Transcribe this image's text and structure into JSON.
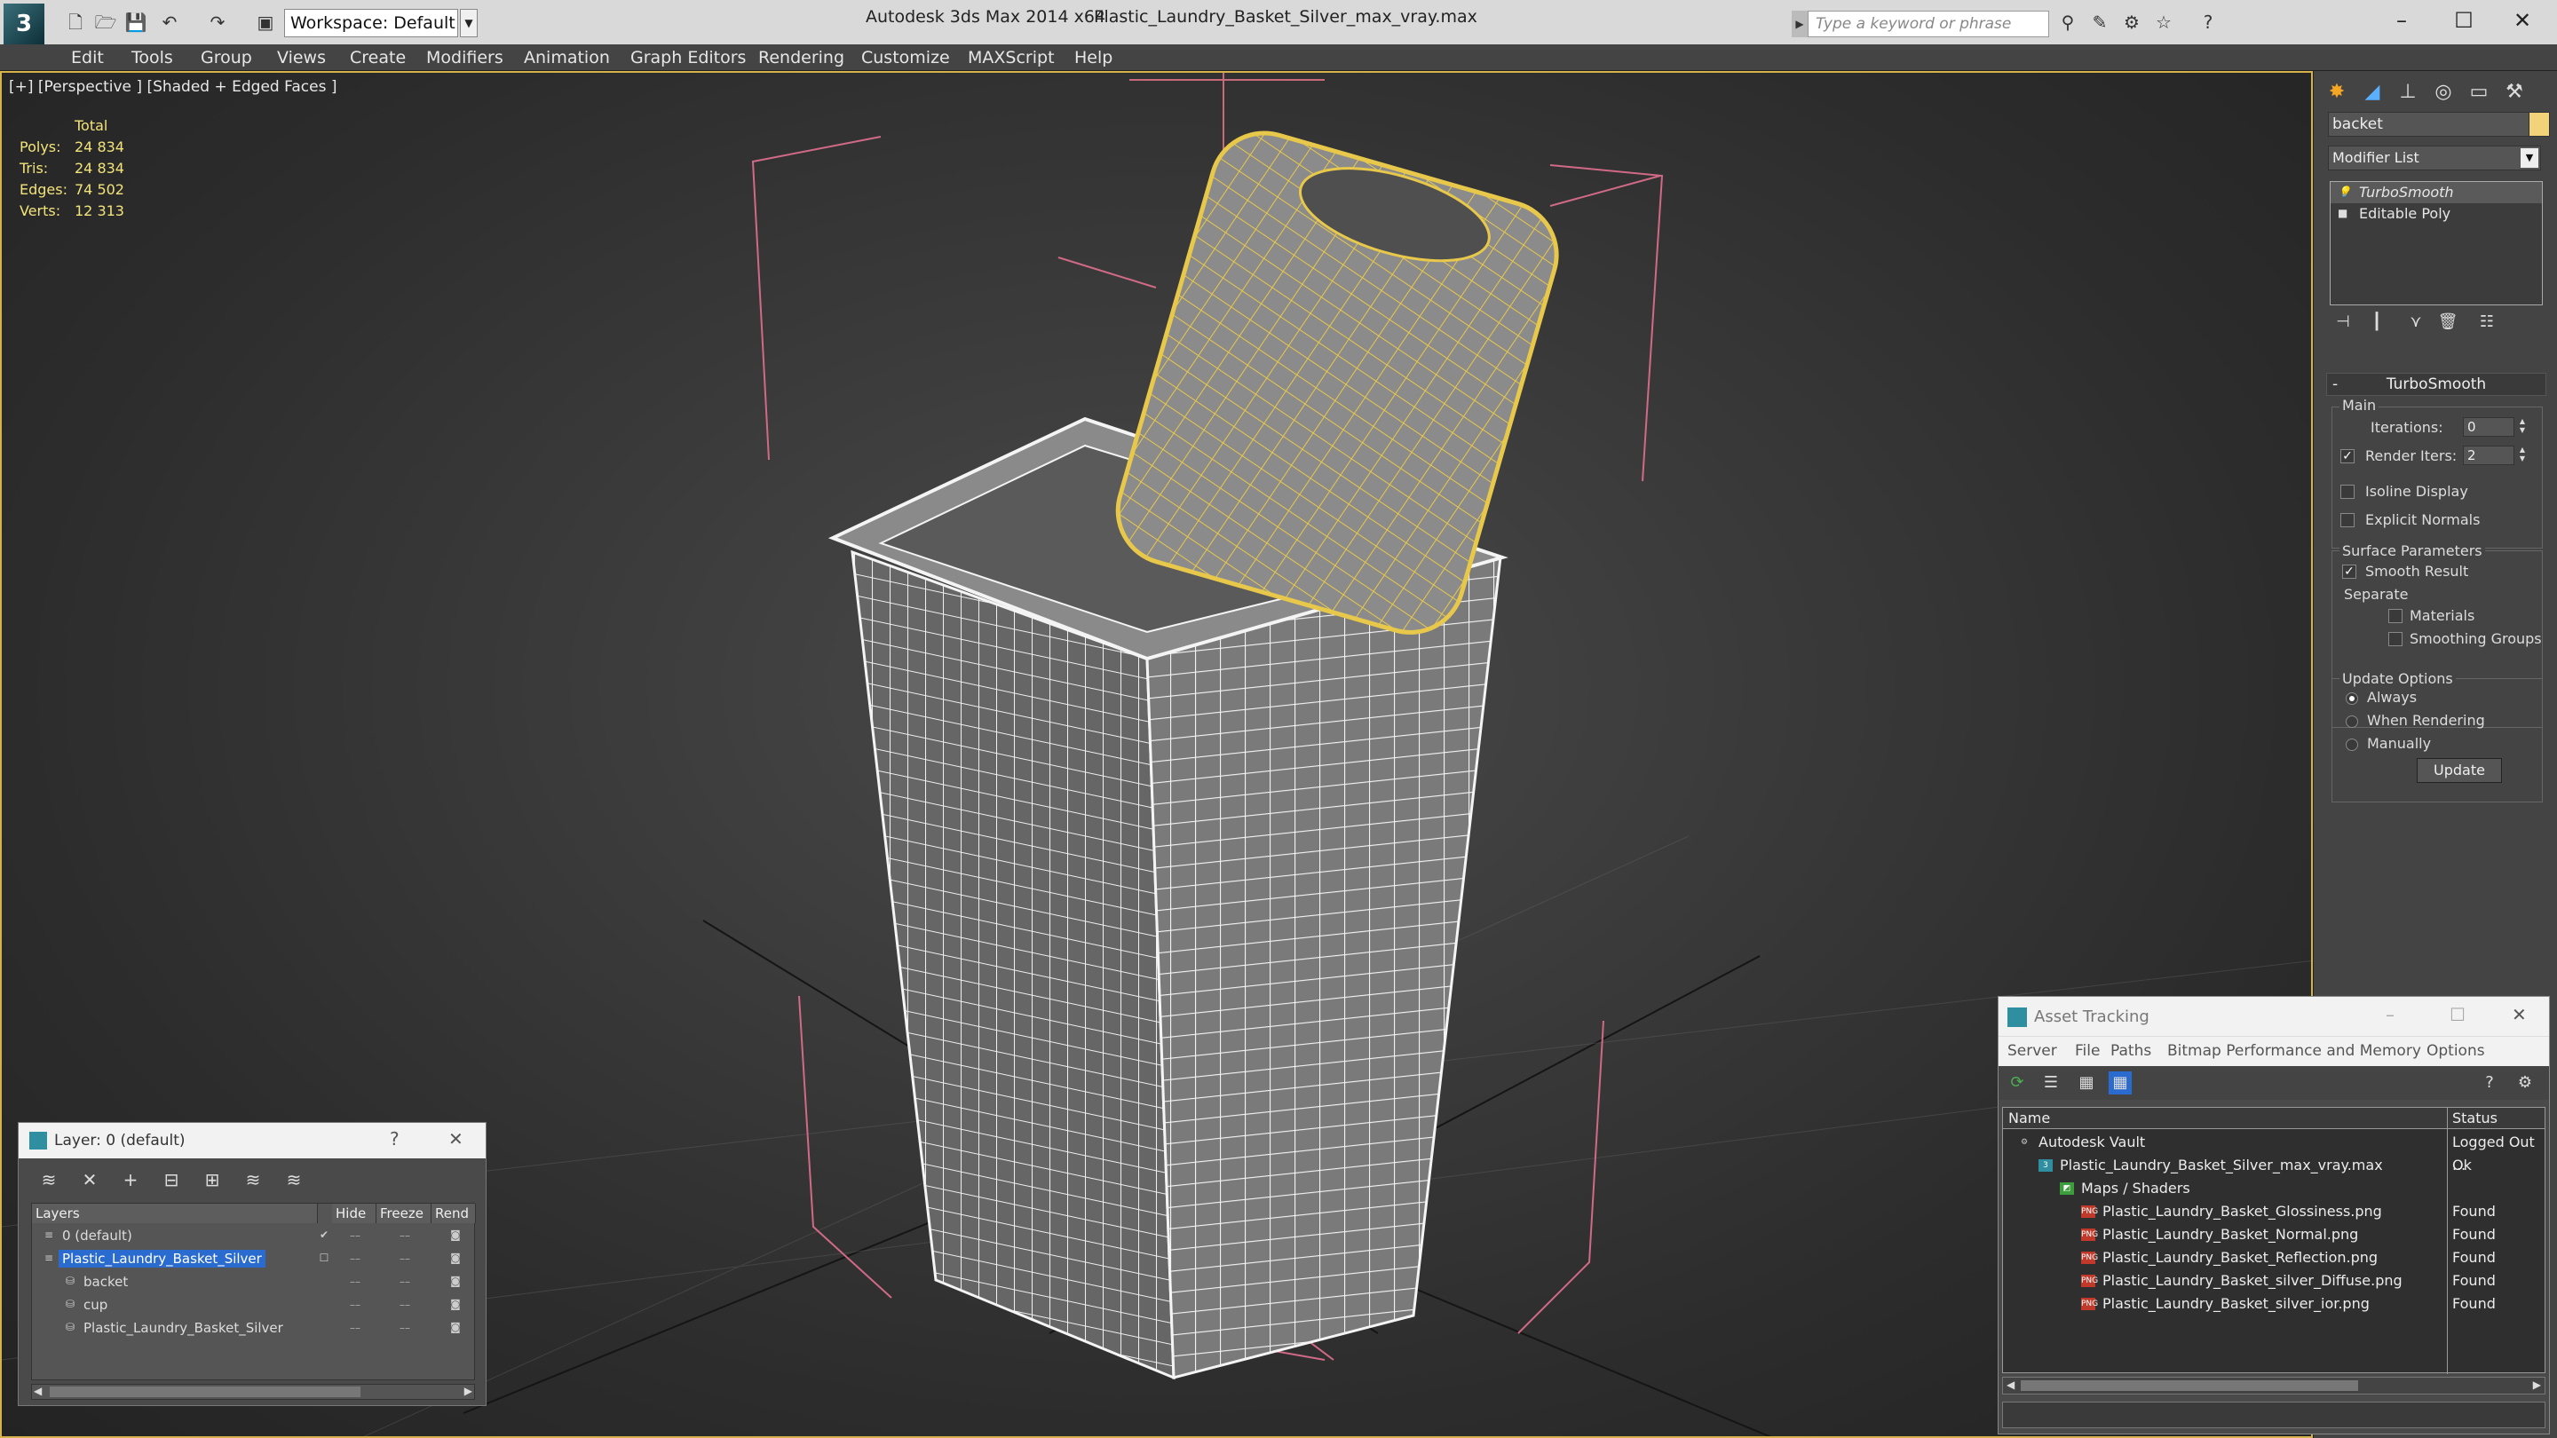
{
  "titlebar": {
    "workspace": "Workspace: Default",
    "app_title": "Autodesk 3ds Max  2014 x64",
    "file_title": "Plastic_Laundry_Basket_Silver_max_vray.max",
    "search_placeholder": "Type a keyword or phrase"
  },
  "menu": [
    "Edit",
    "Tools",
    "Group",
    "Views",
    "Create",
    "Modifiers",
    "Animation",
    "Graph Editors",
    "Rendering",
    "Customize",
    "MAXScript",
    "Help"
  ],
  "viewport": {
    "label": "[+] [Perspective ] [Shaded + Edged Faces ]",
    "stats": {
      "header": "Total",
      "rows": [
        {
          "name": "Polys:",
          "value": "24 834"
        },
        {
          "name": "Tris:",
          "value": "24 834"
        },
        {
          "name": "Edges:",
          "value": "74 502"
        },
        {
          "name": "Verts:",
          "value": "12 313"
        }
      ]
    }
  },
  "command_panel": {
    "object_name": "backet",
    "object_color": "#f3d37a",
    "modifier_list": "Modifier List",
    "stack": [
      "TurboSmooth",
      "Editable Poly"
    ],
    "rollout_title": "TurboSmooth",
    "main_group": "Main",
    "iterations_label": "Iterations:",
    "iterations_value": "0",
    "render_iters_label": "Render Iters:",
    "render_iters_value": "2",
    "render_iters_checked": true,
    "isoline_label": "Isoline Display",
    "explicit_normals_label": "Explicit Normals",
    "surface_group": "Surface Parameters",
    "smooth_result_label": "Smooth Result",
    "separate_label": "Separate",
    "materials_label": "Materials",
    "smoothing_groups_label": "Smoothing Groups",
    "update_group": "Update Options",
    "always_label": "Always",
    "when_rendering_label": "When Rendering",
    "manually_label": "Manually",
    "update_button": "Update"
  },
  "layer_dialog": {
    "title": "Layer: 0 (default)",
    "help": "?",
    "close": "✕",
    "columns": [
      "Layers",
      "Hide",
      "Freeze",
      "Rend"
    ],
    "rows": [
      {
        "name": "0 (default)",
        "indent": 0,
        "selected": false,
        "checked": true
      },
      {
        "name": "Plastic_Laundry_Basket_Silver",
        "indent": 0,
        "selected": true,
        "checked": false
      },
      {
        "name": "backet",
        "indent": 1,
        "selected": false,
        "checked": false
      },
      {
        "name": "cup",
        "indent": 1,
        "selected": false,
        "checked": false
      },
      {
        "name": "Plastic_Laundry_Basket_Silver",
        "indent": 1,
        "selected": false,
        "checked": false
      }
    ]
  },
  "asset_dialog": {
    "title": "Asset Tracking",
    "menu": [
      "Server",
      "File",
      "Paths",
      "Bitmap Performance and Memory",
      "Options"
    ],
    "columns": [
      "Name",
      "Status"
    ],
    "rows": [
      {
        "name": "Autodesk Vault",
        "status": "Logged Out ...",
        "indent": 0,
        "icon": "vault-icon"
      },
      {
        "name": "Plastic_Laundry_Basket_Silver_max_vray.max",
        "status": "Ok",
        "indent": 1,
        "icon": "max-file-icon"
      },
      {
        "name": "Maps / Shaders",
        "status": "",
        "indent": 2,
        "icon": "maps-icon"
      },
      {
        "name": "Plastic_Laundry_Basket_Glossiness.png",
        "status": "Found",
        "indent": 3,
        "icon": "png-icon"
      },
      {
        "name": "Plastic_Laundry_Basket_Normal.png",
        "status": "Found",
        "indent": 3,
        "icon": "png-icon"
      },
      {
        "name": "Plastic_Laundry_Basket_Reflection.png",
        "status": "Found",
        "indent": 3,
        "icon": "png-icon"
      },
      {
        "name": "Plastic_Laundry_Basket_silver_Diffuse.png",
        "status": "Found",
        "indent": 3,
        "icon": "png-icon"
      },
      {
        "name": "Plastic_Laundry_Basket_silver_ior.png",
        "status": "Found",
        "indent": 3,
        "icon": "png-icon"
      }
    ]
  }
}
